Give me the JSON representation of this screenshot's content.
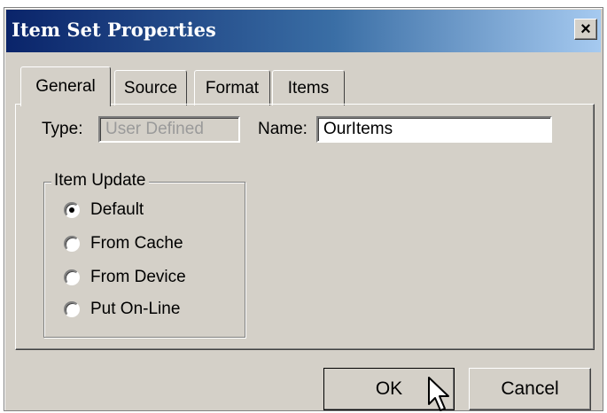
{
  "window": {
    "title": "Item Set Properties",
    "close_glyph": "×"
  },
  "tabs": [
    {
      "label": "General",
      "active": true
    },
    {
      "label": "Source",
      "active": false
    },
    {
      "label": "Format",
      "active": false
    },
    {
      "label": "Items",
      "active": false
    }
  ],
  "general": {
    "type_label": "Type:",
    "type_value": "User Defined",
    "name_label": "Name:",
    "name_value": "OurItems",
    "item_update": {
      "title": "Item Update",
      "options": [
        {
          "label": "Default",
          "selected": true
        },
        {
          "label": "From Cache",
          "selected": false
        },
        {
          "label": "From Device",
          "selected": false
        },
        {
          "label": "Put On-Line",
          "selected": false
        }
      ]
    }
  },
  "buttons": {
    "ok_label": "OK",
    "cancel_label": "Cancel"
  },
  "colors": {
    "dialog_face": "#d4d0c8",
    "title_gradient_start": "#0a246a",
    "title_gradient_end": "#a6caf0"
  },
  "icons": {
    "close": "close-icon",
    "cursor": "arrow-cursor-icon"
  }
}
